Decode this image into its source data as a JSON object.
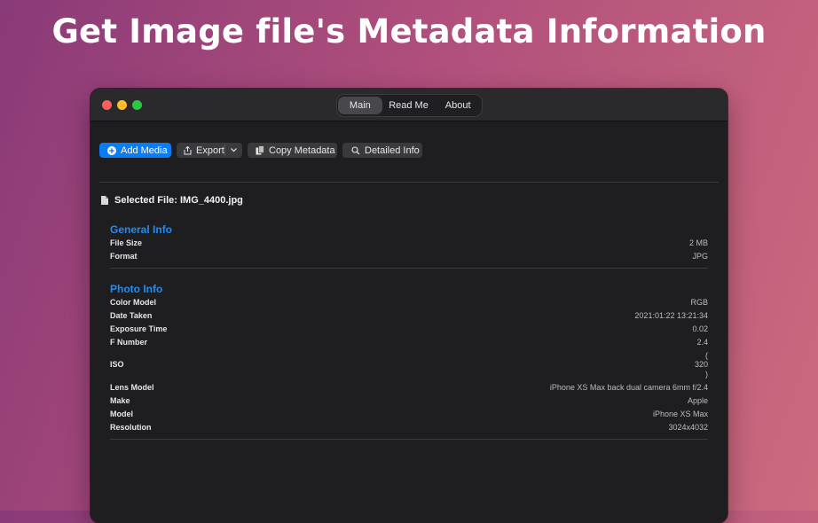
{
  "headline": "Get Image file's Metadata Information",
  "tabs": [
    "Main",
    "Read Me",
    "About"
  ],
  "toolbar": {
    "add_media": "Add Media",
    "export": "Export",
    "copy_metadata": "Copy Metadata",
    "detailed_info": "Detailed Info"
  },
  "selected_file": "Selected File: IMG_4400.jpg",
  "general": {
    "title": "General Info",
    "rows": [
      {
        "key": "File Size",
        "value": "2 MB"
      },
      {
        "key": "Format",
        "value": "JPG"
      }
    ]
  },
  "photo": {
    "title": "Photo Info",
    "rows": [
      {
        "key": "Color Model",
        "value": "RGB"
      },
      {
        "key": "Date Taken",
        "value": "2021:01:22 13:21:34"
      },
      {
        "key": "Exposure Time",
        "value": "0.02"
      },
      {
        "key": "F Number",
        "value": "2.4"
      },
      {
        "key": "ISO",
        "value": "320"
      },
      {
        "key": "Lens Model",
        "value": "iPhone XS Max back dual camera 6mm f/2.4"
      },
      {
        "key": "Make",
        "value": "Apple"
      },
      {
        "key": "Model",
        "value": "iPhone XS Max"
      },
      {
        "key": "Resolution",
        "value": "3024x4032"
      }
    ],
    "iso_open": "(",
    "iso_close": ")"
  },
  "colors": {
    "accent": "#0a7cf5",
    "section_title": "#1e8ef5",
    "window_bg": "#1e1e20"
  }
}
